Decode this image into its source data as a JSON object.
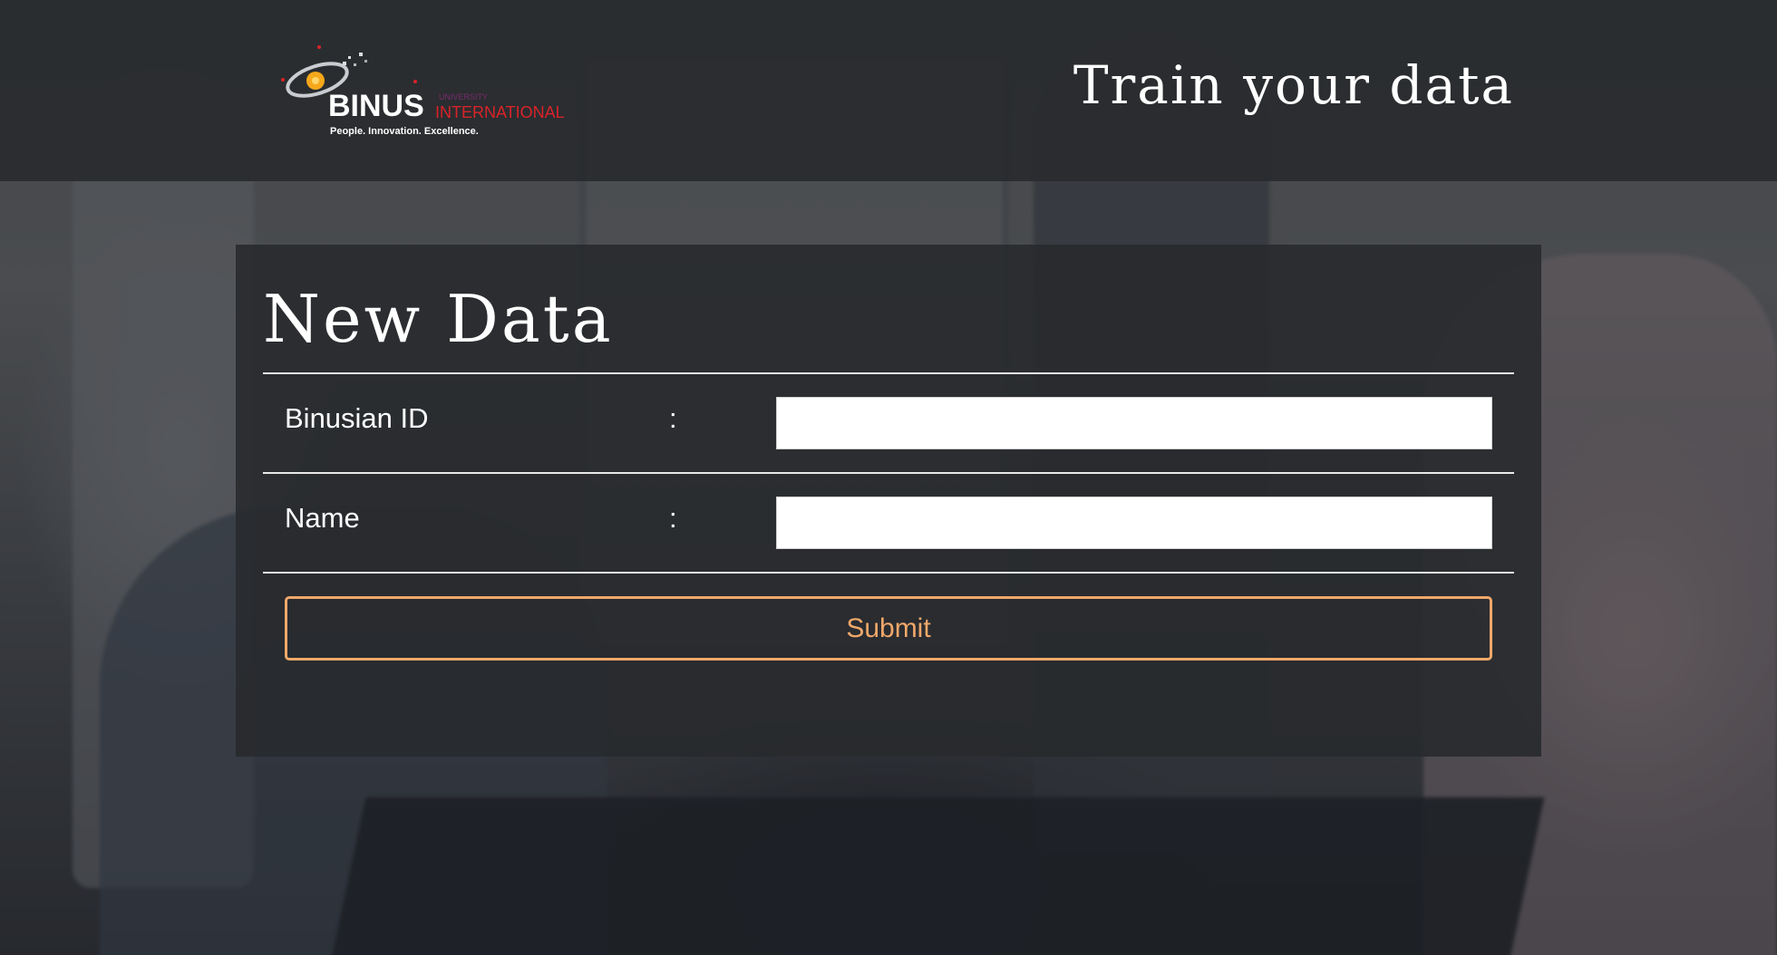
{
  "header": {
    "title": "Train your data",
    "logo": {
      "name": "BINUS",
      "sub_small": "UNIVERSITY",
      "sub": "INTERNATIONAL",
      "tagline": "People. Innovation. Excellence."
    }
  },
  "form": {
    "title": "New Data",
    "fields": [
      {
        "label": "Binusian ID",
        "separator": ":",
        "value": "",
        "placeholder": ""
      },
      {
        "label": "Name",
        "separator": ":",
        "value": "",
        "placeholder": ""
      }
    ],
    "submit_label": "Submit"
  },
  "colors": {
    "accent": "#f0a86a",
    "header_bg": "#2a2c2f",
    "panel_bg": "#282a2d",
    "logo_red": "#d8232a"
  }
}
